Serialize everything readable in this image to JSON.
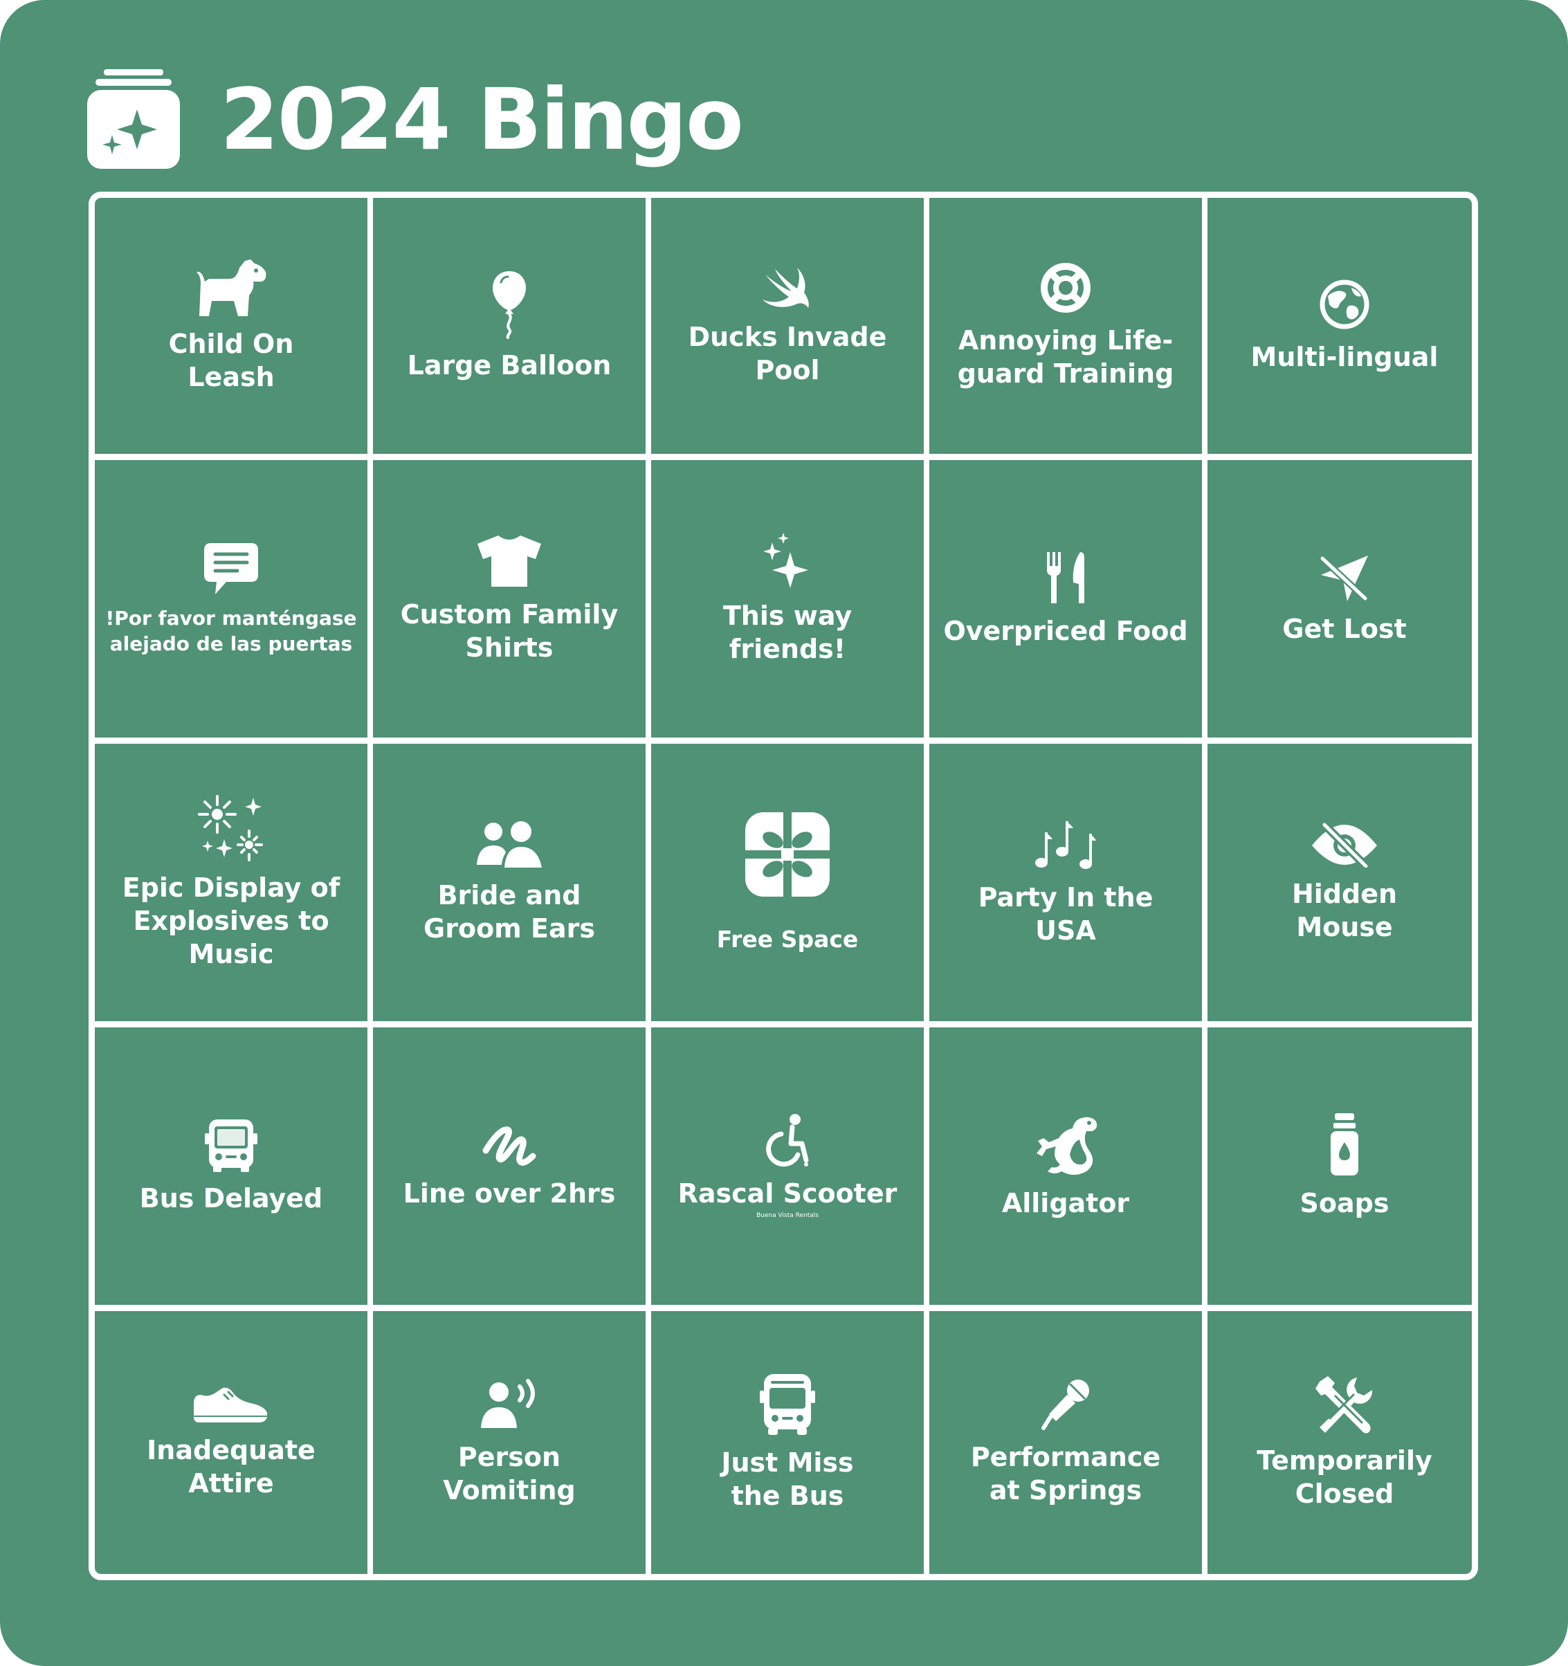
{
  "title": "2024 Bingo",
  "colors": {
    "background": "#4f9276",
    "foreground": "#ffffff"
  },
  "header_icon": "sparkle-card-stack-icon",
  "cells": [
    {
      "icon": "dog-icon",
      "label": "Child On\nLeash"
    },
    {
      "icon": "balloon-icon",
      "label": "Large Balloon"
    },
    {
      "icon": "swift-bird-icon",
      "label": "Ducks Invade\nPool"
    },
    {
      "icon": "lifepreserver-icon",
      "label": "Annoying Life-\nguard Training"
    },
    {
      "icon": "globe-icon",
      "label": "Multi-lingual"
    },
    {
      "icon": "speech-bubble-icon",
      "label": "!Por favor manténgase\nalejado de las puertas"
    },
    {
      "icon": "tshirt-icon",
      "label": "Custom Family\nShirts"
    },
    {
      "icon": "sparkles-icon",
      "label": "This way friends!"
    },
    {
      "icon": "fork-knife-icon",
      "label": "Overpriced Food"
    },
    {
      "icon": "location-slash-icon",
      "label": "Get Lost"
    },
    {
      "icon": "fireworks-icon",
      "label": "Epic Display of\nExplosives to\nMusic"
    },
    {
      "icon": "two-people-icon",
      "label": "Bride and\nGroom Ears"
    },
    {
      "icon": "gift-icon",
      "label": "Free Space"
    },
    {
      "icon": "music-notes-icon",
      "label": "Party In the\nUSA"
    },
    {
      "icon": "eye-slash-icon",
      "label": "Hidden\nMouse"
    },
    {
      "icon": "bus-front-icon",
      "label": "Bus Delayed"
    },
    {
      "icon": "scribble-icon",
      "label": "Line over 2hrs"
    },
    {
      "icon": "wheelchair-icon",
      "label": "Rascal Scooter",
      "sublabel": "Buena Vista Rentals"
    },
    {
      "icon": "lizard-icon",
      "label": "Alligator"
    },
    {
      "icon": "soap-bottle-icon",
      "label": "Soaps"
    },
    {
      "icon": "shoe-icon",
      "label": "Inadequate\nAttire"
    },
    {
      "icon": "person-speaking-icon",
      "label": "Person\nVomiting"
    },
    {
      "icon": "bus-icon",
      "label": "Just Miss\nthe Bus"
    },
    {
      "icon": "microphone-icon",
      "label": "Performance\nat Springs"
    },
    {
      "icon": "tools-icon",
      "label": "Temporarily\nClosed"
    }
  ]
}
